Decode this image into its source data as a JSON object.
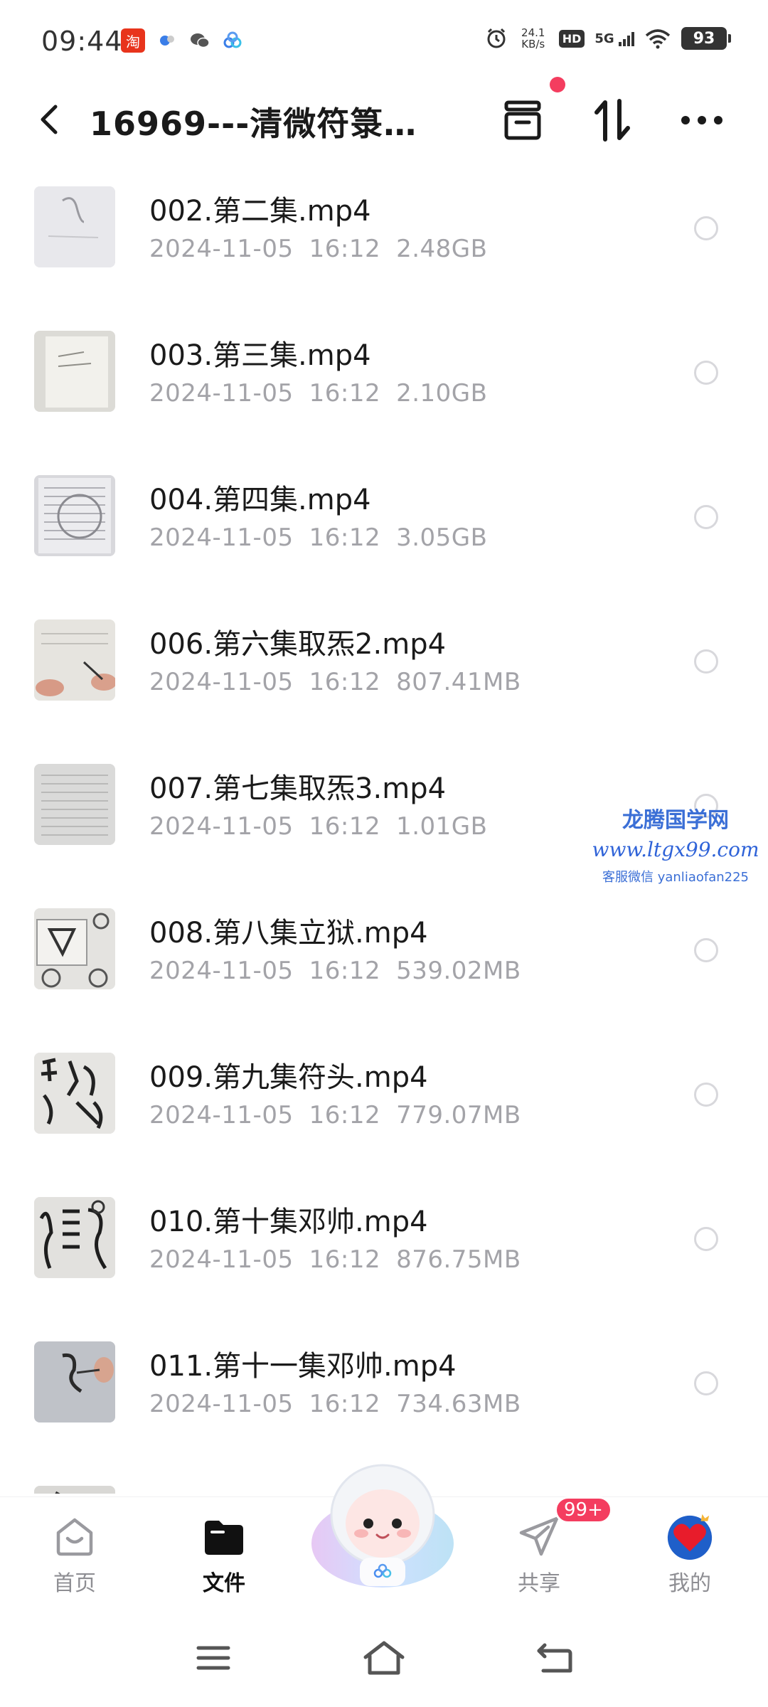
{
  "status_bar": {
    "time": "09:44",
    "taobao_label": "淘",
    "net_speed_value": "24.1",
    "net_speed_unit": "KB/s",
    "hd_label": "HD",
    "network_label": "5G",
    "battery_level": "93"
  },
  "header": {
    "title": "16969---清微符箓…"
  },
  "files": [
    {
      "name": "002.第二集.mp4",
      "date": "2024-11-05",
      "time": "16:12",
      "size": "2.48GB"
    },
    {
      "name": "003.第三集.mp4",
      "date": "2024-11-05",
      "time": "16:12",
      "size": "2.10GB"
    },
    {
      "name": "004.第四集.mp4",
      "date": "2024-11-05",
      "time": "16:12",
      "size": "3.05GB"
    },
    {
      "name": "006.第六集取炁2.mp4",
      "date": "2024-11-05",
      "time": "16:12",
      "size": "807.41MB"
    },
    {
      "name": "007.第七集取炁3.mp4",
      "date": "2024-11-05",
      "time": "16:12",
      "size": "1.01GB"
    },
    {
      "name": "008.第八集立狱.mp4",
      "date": "2024-11-05",
      "time": "16:12",
      "size": "539.02MB"
    },
    {
      "name": "009.第九集符头.mp4",
      "date": "2024-11-05",
      "time": "16:12",
      "size": "779.07MB"
    },
    {
      "name": "010.第十集邓帅.mp4",
      "date": "2024-11-05",
      "time": "16:12",
      "size": "876.75MB"
    },
    {
      "name": "011.第十一集邓帅.mp4",
      "date": "2024-11-05",
      "time": "16:12",
      "size": "734.63MB"
    }
  ],
  "watermark": {
    "title": "龙腾国学网",
    "url": "www.ltgx99.com",
    "contact": "客服微信 yanliaofan225"
  },
  "tabs": {
    "home": "首页",
    "files": "文件",
    "share": "共享",
    "mine": "我的",
    "share_badge": "99+"
  },
  "colors": {
    "accent_red": "#f43d5f",
    "meta_gray": "#a3a3a8",
    "watermark_blue": "#3b6fd6"
  }
}
